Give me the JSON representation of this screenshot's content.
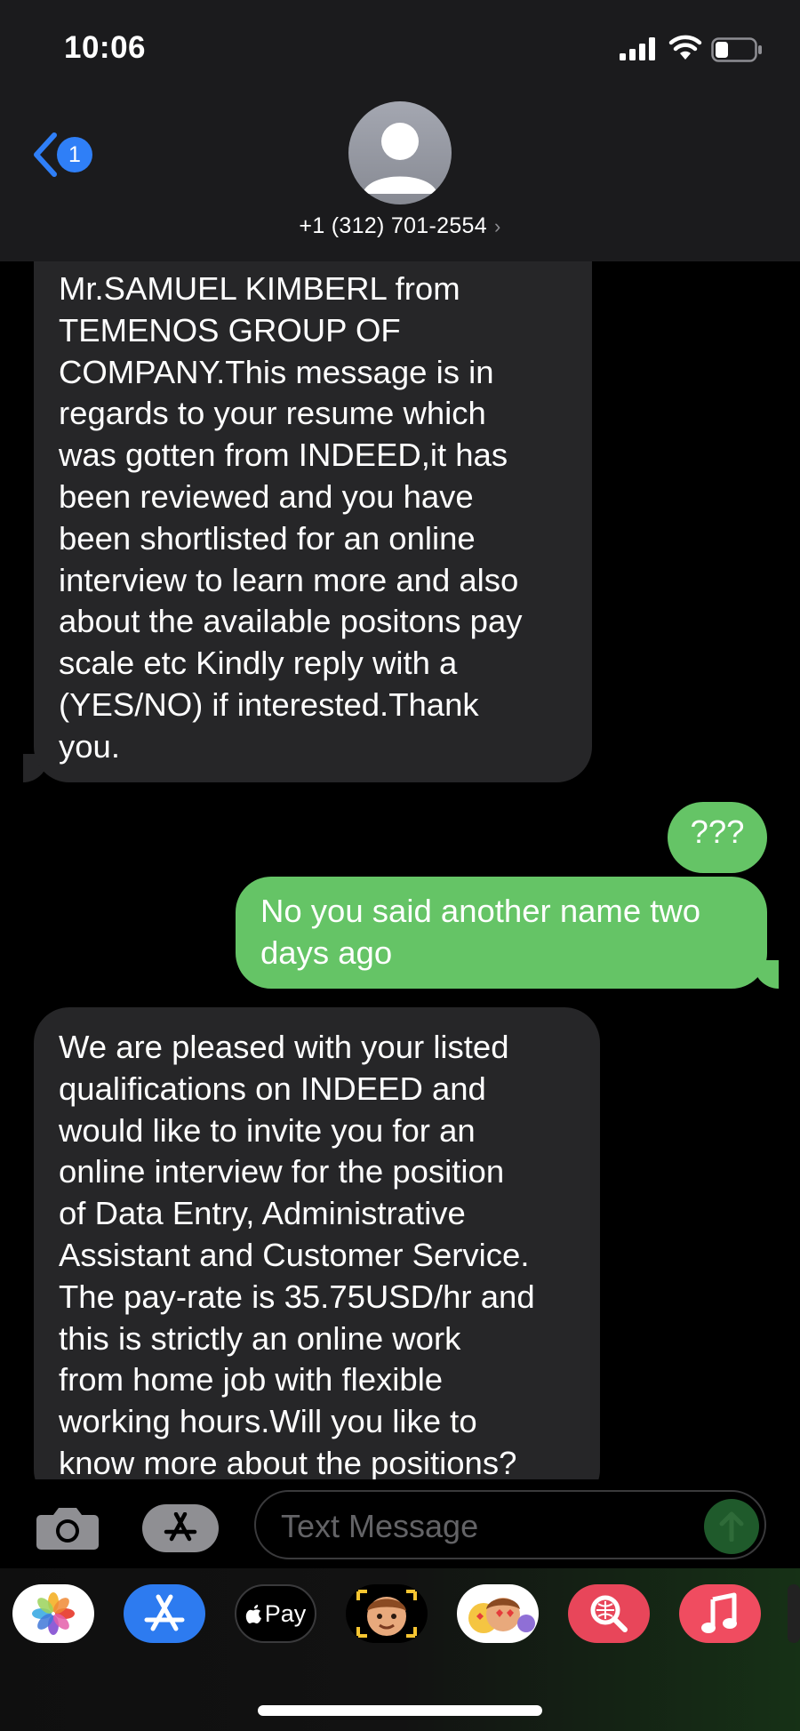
{
  "status_bar": {
    "time": "10:06"
  },
  "header": {
    "back_badge": "1",
    "contact_number": "+1 (312) 701-2554",
    "contact_chevron": "›"
  },
  "messages": [
    {
      "direction": "incoming",
      "lines": "Mr.SAMUEL KIMBERL from\nTEMENOS GROUP OF\nCOMPANY.This message is in\nregards to  your resume which\nwas gotten from INDEED,it has\nbeen reviewed and you have\nbeen shortlisted for an online\ninterview to learn more and also\nabout the available positons pay\nscale etc Kindly reply with a\n(YES/NO) if interested.Thank\nyou."
    },
    {
      "direction": "outgoing",
      "lines": "???"
    },
    {
      "direction": "outgoing",
      "lines": "No you said another name two\ndays ago"
    },
    {
      "direction": "incoming",
      "lines": "We are pleased with your listed\nqualifications on INDEED and\nwould like to invite you for an\nonline interview for the position\nof Data Entry, Administrative\nAssistant and Customer Service.\nThe pay-rate is 35.75USD/hr and\nthis is strictly an online work\nfrom home job with flexible\nworking hours.Will you like to\nknow more about the positions?"
    }
  ],
  "compose": {
    "placeholder": "Text Message"
  },
  "app_drawer": {
    "apps": [
      "photos-icon",
      "app-store-icon",
      "apple-pay-icon",
      "memoji-icon",
      "animoji-stickers-icon",
      "images-search-icon",
      "music-icon"
    ],
    "apple_pay_label": "Pay"
  },
  "colors": {
    "incoming_bubble": "#262628",
    "outgoing_bubble": "#65c466",
    "accent_blue": "#2f7ff7"
  }
}
